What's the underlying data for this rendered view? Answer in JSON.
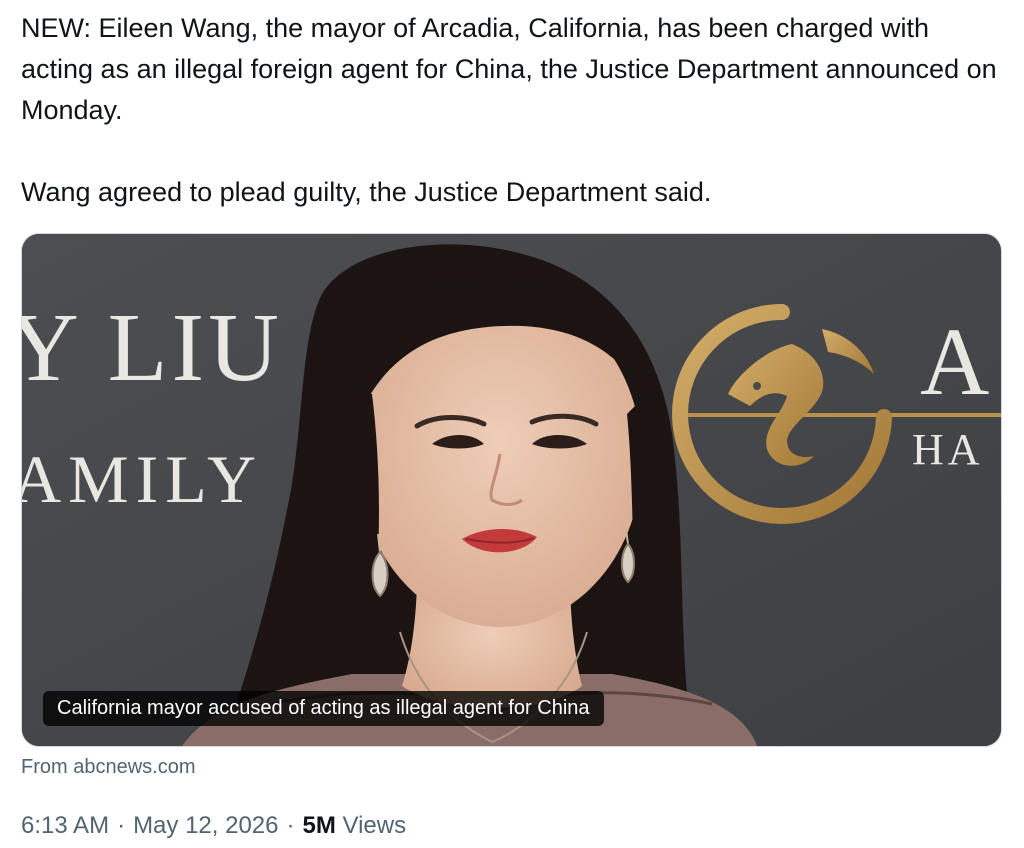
{
  "tweet": {
    "paragraphs": [
      "NEW: Eileen Wang, the mayor of Arcadia, California, has been charged with acting as an illegal foreign agent for China, the Justice Department announced on Monday.",
      "Wang agreed to plead guilty, the Justice Department said."
    ]
  },
  "card": {
    "caption": "California mayor accused of acting as illegal agent for China",
    "source": "From abcnews.com",
    "backdrop_text": {
      "line1": "Y LIU",
      "line2": "AMILY",
      "right_letter": "A",
      "right_sub": "HA"
    },
    "colors": {
      "backdrop": "#47494c",
      "gold": "#b98f4a",
      "caption_bg": "#000000"
    }
  },
  "meta": {
    "time": "6:13 AM",
    "separator": "·",
    "date": "May 12, 2026",
    "views_count": "5M",
    "views_label": "Views"
  }
}
